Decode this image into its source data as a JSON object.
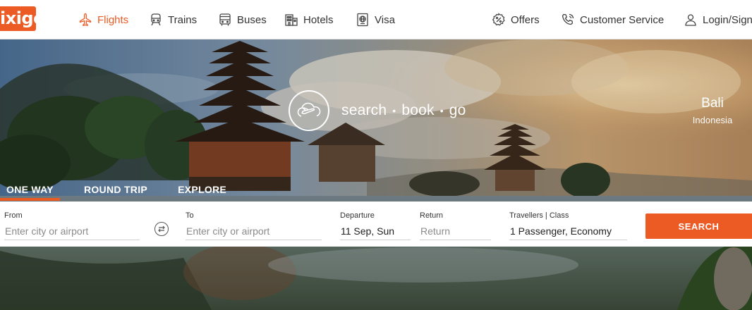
{
  "brand": {
    "logo_text": "ixigo",
    "accent": "#ec5b24"
  },
  "nav": {
    "flights": "Flights",
    "trains": "Trains",
    "buses": "Buses",
    "hotels": "Hotels",
    "visa": "Visa",
    "offers": "Offers",
    "customer_service": "Customer Service",
    "login": "Login/SignUp"
  },
  "hero": {
    "tagline": {
      "search": "search",
      "book": "book",
      "go": "go",
      "separator": "•"
    },
    "location": {
      "city": "Bali",
      "country": "Indonesia"
    }
  },
  "trip_tabs": {
    "one_way": "ONE WAY",
    "round_trip": "ROUND TRIP",
    "explore": "EXPLORE"
  },
  "form": {
    "from": {
      "label": "From",
      "placeholder": "Enter city or airport",
      "value": ""
    },
    "to": {
      "label": "To",
      "placeholder": "Enter city or airport",
      "value": ""
    },
    "departure": {
      "label": "Departure",
      "value": "11 Sep, Sun"
    },
    "return": {
      "label": "Return",
      "placeholder": "Return",
      "value": ""
    },
    "travellers": {
      "label": "Travellers | Class",
      "value": "1 Passenger, Economy"
    },
    "search_label": "SEARCH"
  },
  "icons": [
    "plane-icon",
    "train-icon",
    "bus-icon",
    "hotel-icon",
    "passport-icon",
    "offers-icon",
    "phone-icon",
    "user-icon",
    "swap-icon",
    "plane-cloud-icon"
  ]
}
